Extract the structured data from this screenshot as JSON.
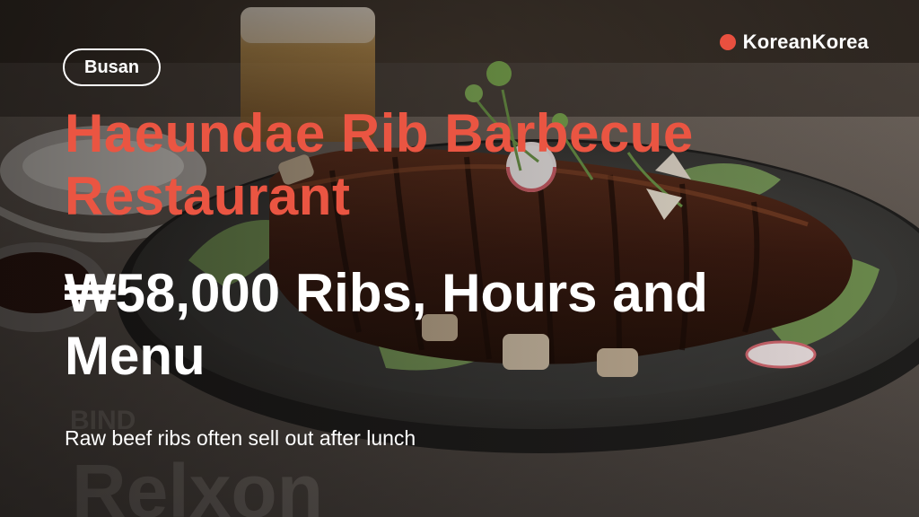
{
  "brand": {
    "name": "KoreanKorea",
    "dot_color": "#e9503f"
  },
  "badge": {
    "label": "Busan"
  },
  "title": "Haeundae Rib Barbecue Restaurant",
  "headline": "₩58,000 Ribs, Hours and Menu",
  "subline": "Raw beef ribs often sell out after lunch",
  "colors": {
    "title": "#ea5542",
    "text": "#ffffff"
  }
}
